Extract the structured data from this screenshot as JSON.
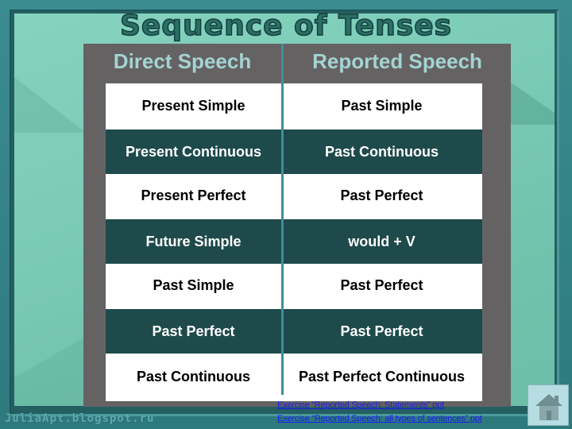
{
  "slide": {
    "title": "Sequence of Tenses",
    "watermark": "JuliaApt.blogspot.ru"
  },
  "table": {
    "headers": [
      "Direct Speech",
      "Reported Speech"
    ],
    "rows": [
      {
        "direct": "Present Simple",
        "reported": "Past Simple",
        "style": "light"
      },
      {
        "direct": "Present Continuous",
        "reported": "Past Continuous",
        "style": "dark"
      },
      {
        "direct": "Present Perfect",
        "reported": "Past Perfect",
        "style": "light"
      },
      {
        "direct": "Future Simple",
        "reported": "would + V",
        "style": "dark"
      },
      {
        "direct": "Past Simple",
        "reported": "Past Perfect",
        "style": "light"
      },
      {
        "direct": "Past Perfect",
        "reported": "Past Perfect",
        "style": "dark"
      },
      {
        "direct": "Past Continuous",
        "reported": "Past Perfect Continuous",
        "style": "light"
      }
    ]
  },
  "links": [
    {
      "label": "Exercise “Reported Speech: Statements” ppt"
    },
    {
      "label": "Exercise “Reported Speech: all types of sentences” ppt"
    }
  ],
  "navigation": {
    "home_icon": "home-icon"
  },
  "colors": {
    "dark_row": "#1e4a4b",
    "light_row": "#ffffff",
    "header_text": "#a4d3d3",
    "panel": "#656263",
    "background": "#7cccb7",
    "link": "#1a1aee"
  }
}
